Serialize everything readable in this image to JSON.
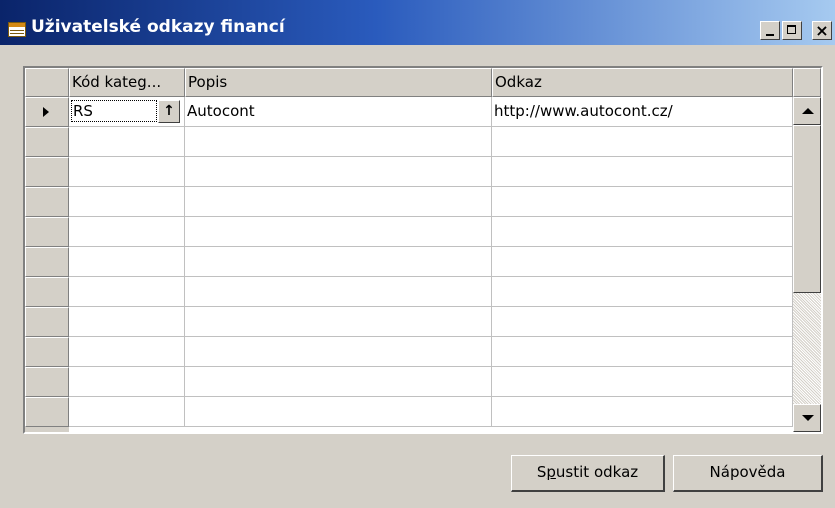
{
  "window": {
    "title": "Uživatelské odkazy financí",
    "close_glyph": "×"
  },
  "grid": {
    "columns": [
      "Kód kateg...",
      "Popis",
      "Odkaz"
    ],
    "rows": [
      {
        "code": "RS",
        "description": "Autocont",
        "link": "http://www.autocont.cz/"
      }
    ],
    "lookup_glyph": "↑",
    "empty_rows": 10
  },
  "buttons": {
    "run_link": {
      "pre": "S",
      "underlined": "p",
      "post": "ustit odkaz"
    },
    "help": "Nápověda"
  },
  "icons": {
    "window": "table-icon",
    "minimize": "minimize-icon",
    "maximize": "maximize-icon",
    "close": "close-icon",
    "row_pointer": "row-pointer-icon",
    "scroll_up": "scroll-up-icon",
    "scroll_down": "scroll-down-icon"
  },
  "colors": {
    "titlebar_start": "#0a246a",
    "titlebar_end": "#a6caf0",
    "face": "#d4d0c8"
  }
}
